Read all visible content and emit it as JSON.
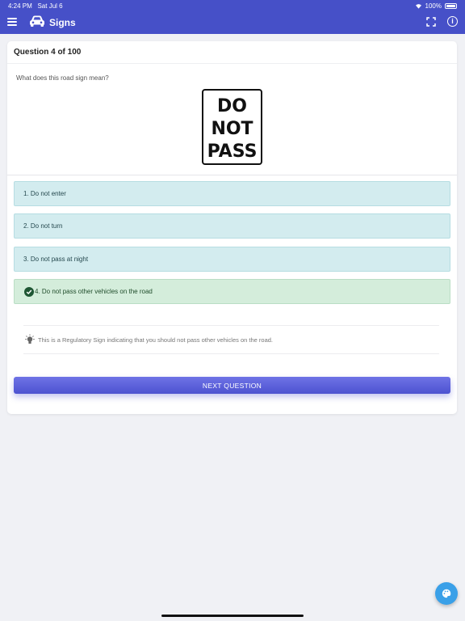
{
  "status_bar": {
    "time": "4:24 PM",
    "date": "Sat Jul 6",
    "battery": "100%",
    "icons": [
      "wifi-icon",
      "battery-icon"
    ]
  },
  "app_bar": {
    "title": "Signs",
    "background_color": "#4650c8",
    "icons": [
      "menu-icon",
      "car-icon",
      "fullscreen-icon",
      "info-icon"
    ]
  },
  "quiz": {
    "header": "Question 4 of 100",
    "question": "What does this road sign mean?",
    "sign_lines": [
      "DO",
      "NOT",
      "PASS"
    ],
    "options": [
      {
        "label": "1. Do not enter",
        "state": "neutral"
      },
      {
        "label": "2. Do not turn",
        "state": "neutral"
      },
      {
        "label": "3. Do not pass at night",
        "state": "neutral"
      },
      {
        "label": "4. Do not pass other vehicles on the road",
        "state": "correct"
      }
    ],
    "explanation": "This is a Regulatory Sign indicating that you should not pass other vehicles on the road.",
    "next_button": "NEXT QUESTION"
  },
  "colors": {
    "option_neutral": "#d3ecef",
    "option_correct": "#d4eddb",
    "button": "#5a5fdc",
    "fab": "#3aa0e8"
  },
  "fab_icon": "palette-icon"
}
